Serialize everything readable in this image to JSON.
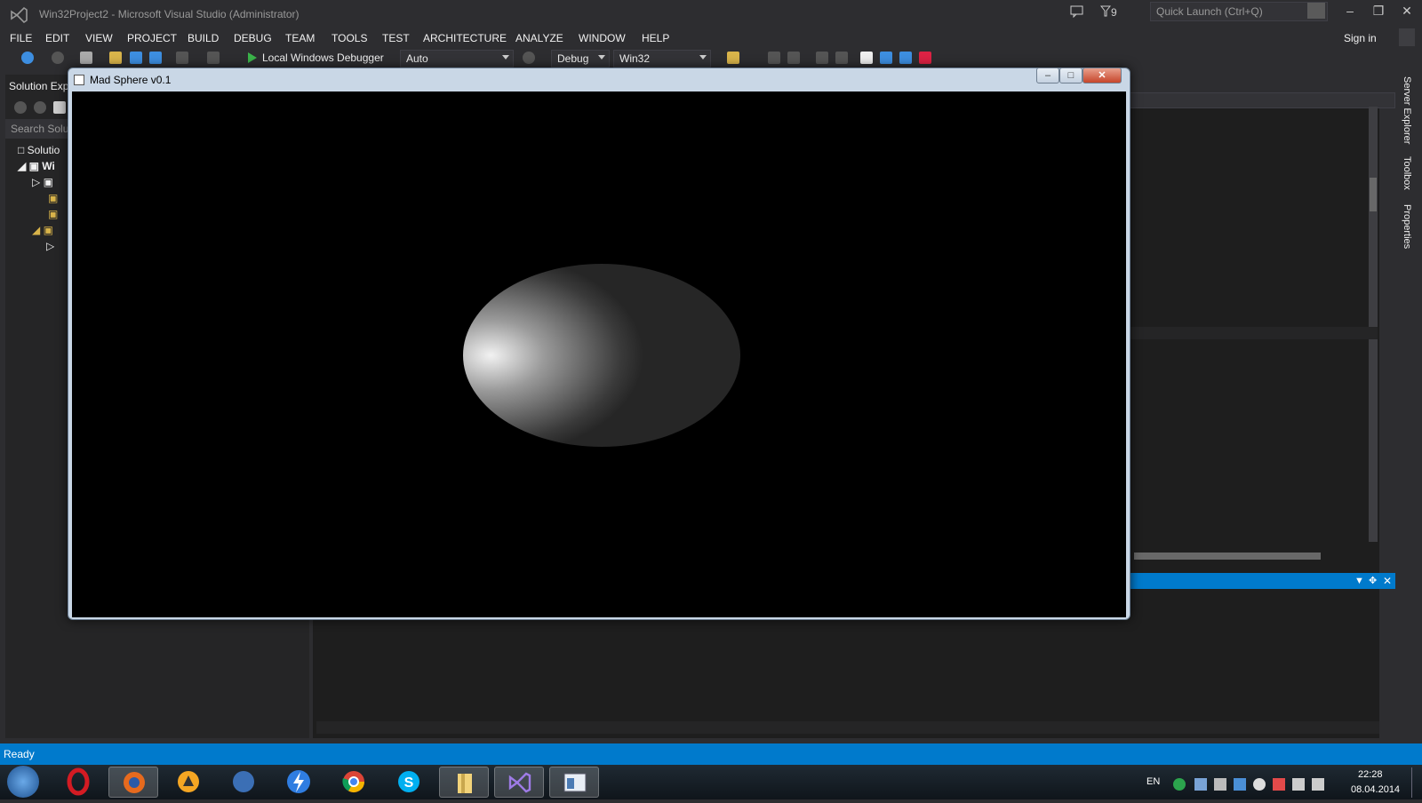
{
  "window": {
    "title": "Win32Project2 - Microsoft Visual Studio (Administrator)",
    "notifications": "9"
  },
  "quick_launch": {
    "placeholder": "Quick Launch (Ctrl+Q)"
  },
  "menu": [
    "FILE",
    "EDIT",
    "VIEW",
    "PROJECT",
    "BUILD",
    "DEBUG",
    "TEAM",
    "TOOLS",
    "TEST",
    "ARCHITECTURE",
    "ANALYZE",
    "WINDOW",
    "HELP"
  ],
  "account": {
    "sign_in": "Sign in"
  },
  "toolbar": {
    "debugger": "Local Windows Debugger",
    "config_auto": "Auto",
    "config": "Debug",
    "platform": "Win32"
  },
  "solution_explorer": {
    "header": "Solution Exp",
    "search_placeholder": "Search Solu",
    "items": [
      "Solutio",
      "Wi"
    ]
  },
  "side_tabs": [
    "Server Explorer",
    "Toolbox",
    "Properties"
  ],
  "status": {
    "text": "Ready"
  },
  "child_window": {
    "title": "Mad Sphere v0.1"
  },
  "taskbar": {
    "lang": "EN",
    "time": "22:28",
    "date": "08.04.2014"
  },
  "colors": {
    "accent": "#007acc",
    "background": "#2d2d30"
  }
}
